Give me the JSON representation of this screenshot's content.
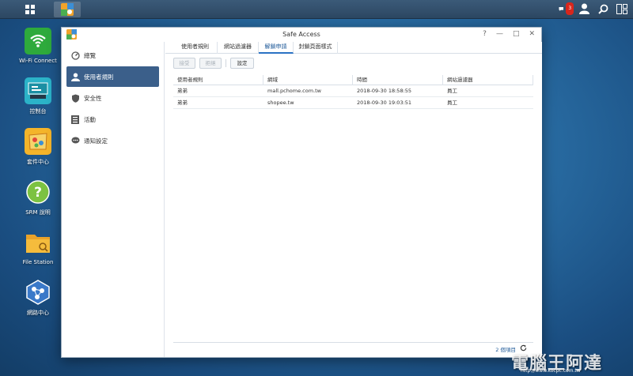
{
  "taskbar": {
    "notification_count": "3"
  },
  "desktop": {
    "icons": [
      {
        "label": "Wi-Fi Connect"
      },
      {
        "label": "控制台"
      },
      {
        "label": "套件中心"
      },
      {
        "label": "SRM 說明"
      },
      {
        "label": "File Station"
      },
      {
        "label": "網路中心"
      }
    ]
  },
  "window": {
    "title": "Safe Access",
    "controls": {
      "help": "?",
      "minimize": "—",
      "maximize": "□",
      "close": "✕"
    }
  },
  "sidebar": {
    "items": [
      {
        "label": "總覽",
        "icon": "gauge-icon"
      },
      {
        "label": "使用者規則",
        "icon": "user-icon"
      },
      {
        "label": "安全性",
        "icon": "shield-icon"
      },
      {
        "label": "活動",
        "icon": "list-icon"
      },
      {
        "label": "通知設定",
        "icon": "chat-icon"
      }
    ],
    "active_index": 1
  },
  "tabs": [
    {
      "label": "使用者規則"
    },
    {
      "label": "網站過濾器"
    },
    {
      "label": "解鎖申請"
    },
    {
      "label": "封鎖頁面樣式"
    }
  ],
  "toolbar": {
    "accept_label": "接受",
    "reject_label": "拒絕",
    "settings_label": "設定"
  },
  "table": {
    "columns": [
      "使用者規則",
      "網域",
      "時間",
      "網站過濾器"
    ],
    "rows": [
      [
        "弟弟",
        "mall.pchome.com.tw",
        "2018-09-30 18:58:55",
        "員工"
      ],
      [
        "弟弟",
        "shopee.tw",
        "2018-09-30 19:03:51",
        "員工"
      ]
    ]
  },
  "footer": {
    "item_count": "2 個項目"
  },
  "watermark": {
    "text": "電腦王阿達",
    "url": "http://www.kocpc.com.tw"
  },
  "colors": {
    "accent": "#2a72c4",
    "sidebar_active": "#3b5f8a",
    "desktop_bg": "#2a6fa6"
  }
}
